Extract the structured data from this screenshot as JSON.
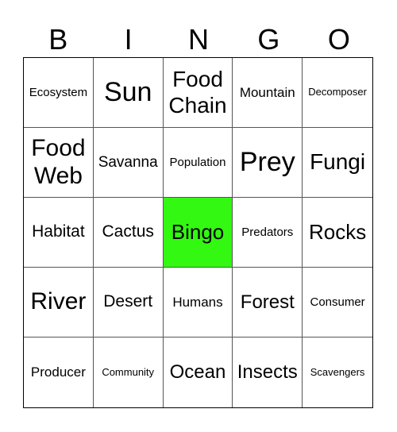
{
  "header": [
    "B",
    "I",
    "N",
    "G",
    "O"
  ],
  "colors": {
    "free_space": "#33f812"
  },
  "cells": [
    {
      "text": "Ecosystem",
      "size": "s15"
    },
    {
      "text": "Sun",
      "size": "s34"
    },
    {
      "text": "Food Chain",
      "size": "s28"
    },
    {
      "text": "Mountain",
      "size": "s17"
    },
    {
      "text": "Decomposer",
      "size": "s13"
    },
    {
      "text": "Food Web",
      "size": "s30"
    },
    {
      "text": "Savanna",
      "size": "s19"
    },
    {
      "text": "Population",
      "size": "s15"
    },
    {
      "text": "Prey",
      "size": "s34"
    },
    {
      "text": "Fungi",
      "size": "s28"
    },
    {
      "text": "Habitat",
      "size": "s21"
    },
    {
      "text": "Cactus",
      "size": "s21"
    },
    {
      "text": "Bingo",
      "size": "s26",
      "free": true
    },
    {
      "text": "Predators",
      "size": "s15"
    },
    {
      "text": "Rocks",
      "size": "s26"
    },
    {
      "text": "River",
      "size": "s30"
    },
    {
      "text": "Desert",
      "size": "s21"
    },
    {
      "text": "Humans",
      "size": "s17"
    },
    {
      "text": "Forest",
      "size": "s24"
    },
    {
      "text": "Consumer",
      "size": "s15"
    },
    {
      "text": "Producer",
      "size": "s17"
    },
    {
      "text": "Community",
      "size": "s13"
    },
    {
      "text": "Ocean",
      "size": "s24"
    },
    {
      "text": "Insects",
      "size": "s24"
    },
    {
      "text": "Scavengers",
      "size": "s13"
    }
  ]
}
